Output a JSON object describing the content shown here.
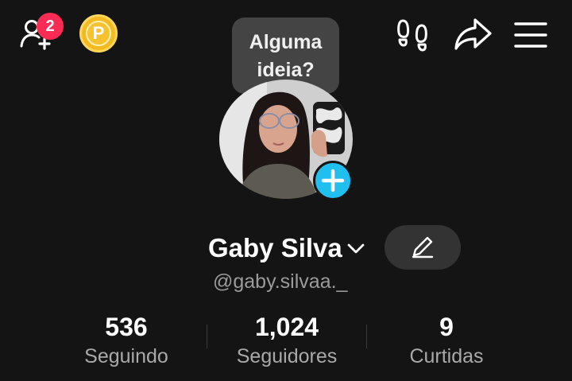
{
  "top_bar": {
    "friends_badge_count": "2",
    "coin_letter": "P"
  },
  "tooltip": {
    "line1": "Alguma",
    "line2": "ideia?"
  },
  "profile": {
    "display_name": "Gaby Silva",
    "username": "@gaby.silvaa._"
  },
  "stats": [
    {
      "value": "536",
      "label": "Seguindo"
    },
    {
      "value": "1,024",
      "label": "Seguidores"
    },
    {
      "value": "9",
      "label": "Curtidas"
    }
  ],
  "colors": {
    "background": "#141414",
    "badge": "#fe2c55",
    "coin": "#f5b921",
    "avatar_add": "#20bff0",
    "tooltip": "#444444",
    "edit_button": "#333333"
  },
  "icons": {
    "add_friend": "add-friend-icon",
    "coin": "coin-icon",
    "footsteps": "footsteps-icon",
    "share": "share-arrow-icon",
    "menu": "hamburger-menu-icon",
    "edit": "pencil-icon",
    "dropdown": "chevron-down-icon",
    "avatar_add": "plus-icon"
  }
}
